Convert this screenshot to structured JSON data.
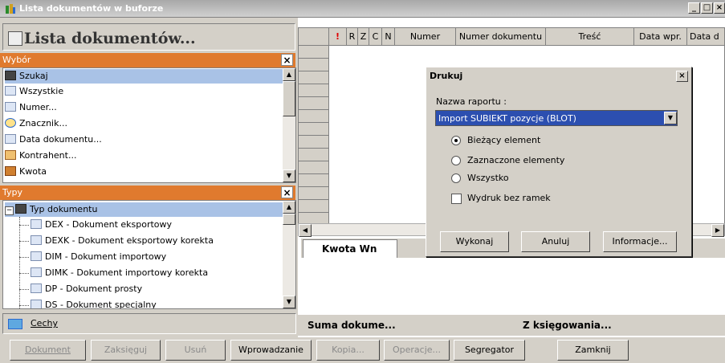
{
  "window": {
    "title": "Lista dokumentów w buforze"
  },
  "header": {
    "title": "Lista dokumentów..."
  },
  "wybor": {
    "label": "Wybór",
    "items": [
      "Szukaj",
      "Wszystkie",
      "Numer...",
      "Znacznik...",
      "Data dokumentu...",
      "Kontrahent...",
      "Kwota"
    ]
  },
  "typy": {
    "label": "Typy",
    "root": "Typ dokumentu",
    "items": [
      "DEX - Dokument eksportowy",
      "DEXK - Dokument eksportowy korekta",
      "DIM - Dokument importowy",
      "DIMK - Dokument importowy korekta",
      "DP - Dokument prosty",
      "DS - Dokument specjalny"
    ]
  },
  "cechy": {
    "label": "Cechy"
  },
  "grid": {
    "columns": [
      "!",
      "R",
      "Z",
      "C",
      "N",
      "Numer",
      "Numer dokumentu",
      "Treść",
      "Data wpr.",
      "Data d"
    ]
  },
  "footer": {
    "kwota": "Kwota Wn",
    "suma": "Suma dokume...",
    "ksieg": "Z księgowania..."
  },
  "toolbar": [
    "Dokument",
    "Zaksięguj",
    "Usuń",
    "Wprowadzanie",
    "Kopia...",
    "Operacje...",
    "Segregator",
    "Zamknij"
  ],
  "dialog": {
    "title": "Drukuj",
    "report_label": "Nazwa raportu :",
    "report_value": "Import SUBIEKT pozycje (BLOT)",
    "options": [
      "Bieżący element",
      "Zaznaczone elementy",
      "Wszystko"
    ],
    "checkbox": "Wydruk bez ramek",
    "buttons": [
      "Wykonaj",
      "Anuluj",
      "Informacje..."
    ]
  }
}
